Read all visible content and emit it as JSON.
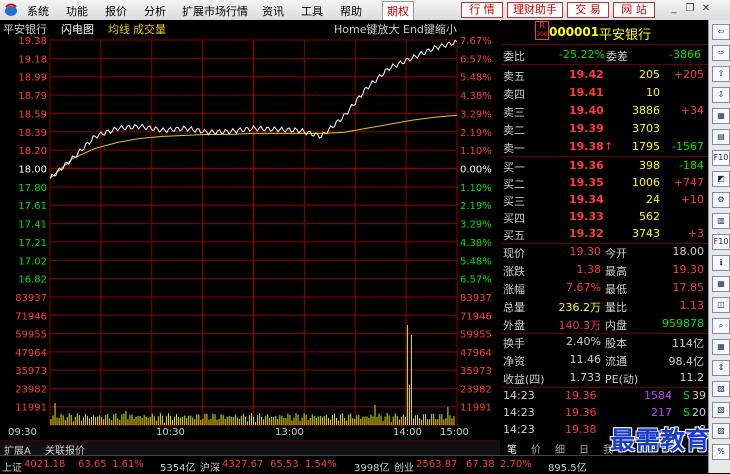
{
  "menu": {
    "items": [
      "系统",
      "功能",
      "报价",
      "分析",
      "扩展市场行情",
      "资讯",
      "工具",
      "帮助"
    ],
    "active": "期权",
    "buttons": [
      "行 情",
      "理财助手",
      "交 易",
      "网 站"
    ]
  },
  "chart": {
    "stock_name": "平安银行",
    "chart_label": "闪电图",
    "avg_label": "均线",
    "vol_label": "成交量",
    "hint": "Home键放大 End键缩小",
    "price_ticks_left": [
      "19.38",
      "19.18",
      "18.99",
      "18.79",
      "18.59",
      "18.39",
      "18.20",
      "18.00",
      "17.80",
      "17.61",
      "17.41",
      "17.21",
      "17.02",
      "16.82"
    ],
    "pct_ticks_right": [
      "7.67%",
      "6.57%",
      "5.48%",
      "4.38%",
      "3.29%",
      "2.19%",
      "1.10%",
      "0.00%",
      "1.10%",
      "2.19%",
      "3.29%",
      "4.38%",
      "5.48%",
      "6.57%"
    ],
    "vol_ticks_left": [
      "83937",
      "71946",
      "59955",
      "47964",
      "35973",
      "23982",
      "11991"
    ],
    "vol_ticks_right": [
      "83937",
      "71946",
      "59955",
      "47964",
      "35973",
      "23982",
      "11991"
    ],
    "time_ticks": [
      "09:30",
      "10:30",
      "13:00",
      "14:00",
      "15:00"
    ],
    "colors": {
      "price": "#ffffff",
      "avg": "#e6c800",
      "grid": "#8b0000",
      "volume": "#e6e600",
      "up": "#ff3b3b",
      "flat": "#ffffff",
      "down": "#00e400"
    }
  },
  "chart_data": {
    "type": "line",
    "title": "平安银行",
    "x": [
      "09:30",
      "09:45",
      "10:00",
      "10:15",
      "10:30",
      "10:45",
      "11:00",
      "11:15",
      "11:30",
      "13:15",
      "13:30",
      "13:45",
      "14:00",
      "14:10",
      "14:20",
      "14:30",
      "14:40",
      "14:50",
      "15:00"
    ],
    "series": [
      {
        "name": "",
        "values": [
          18.0,
          18.2,
          18.42,
          18.5,
          18.52,
          18.48,
          18.5,
          18.46,
          18.47,
          18.5,
          18.49,
          18.48,
          18.42,
          18.62,
          18.9,
          19.1,
          19.2,
          19.3,
          19.36
        ]
      },
      {
        "name": "均线",
        "values": [
          18.0,
          18.2,
          18.3,
          18.36,
          18.4,
          18.42,
          18.43,
          18.44,
          18.44,
          18.45,
          18.45,
          18.45,
          18.45,
          18.46,
          18.5,
          18.54,
          18.58,
          18.61,
          18.63
        ]
      }
    ],
    "ylim": [
      16.82,
      19.38
    ],
    "volume_ylim": [
      0,
      83937
    ]
  },
  "quote": {
    "code": "000001",
    "name": "平安银行",
    "badge_top": "R",
    "badge_bottom": "300",
    "weibi_label": "委比",
    "weibi_value": "-25.22%",
    "weicha_label": "委差",
    "weicha_value": "-3866",
    "asks": [
      {
        "label": "卖五",
        "price": "19.42",
        "vol": "205",
        "chg": "+205"
      },
      {
        "label": "卖四",
        "price": "19.41",
        "vol": "10",
        "chg": ""
      },
      {
        "label": "卖三",
        "price": "19.40",
        "vol": "3886",
        "chg": "+34"
      },
      {
        "label": "卖二",
        "price": "19.39",
        "vol": "3703",
        "chg": ""
      },
      {
        "label": "卖一",
        "price": "19.38",
        "vol": "1795",
        "chg": "-1567",
        "arrow": "↑"
      }
    ],
    "bids": [
      {
        "label": "买一",
        "price": "19.36",
        "vol": "398",
        "chg": "-184"
      },
      {
        "label": "买二",
        "price": "19.35",
        "vol": "1006",
        "chg": "+747"
      },
      {
        "label": "买三",
        "price": "19.34",
        "vol": "24",
        "chg": "+10"
      },
      {
        "label": "买四",
        "price": "19.33",
        "vol": "562",
        "chg": ""
      },
      {
        "label": "买五",
        "price": "19.32",
        "vol": "3743",
        "chg": "+3"
      }
    ],
    "stats": [
      {
        "l1": "现价",
        "v1": "19.30",
        "l2": "今开",
        "v2": "18.00"
      },
      {
        "l1": "涨跌",
        "v1": "1.38",
        "l2": "最高",
        "v2": "19.30"
      },
      {
        "l1": "涨幅",
        "v1": "7.67%",
        "l2": "最低",
        "v2": "17.85"
      },
      {
        "l1": "总量",
        "v1": "236.2万",
        "l2": "量比",
        "v2": "1.13"
      },
      {
        "l1": "外盘",
        "v1": "140.3万",
        "l2": "内盘",
        "v2": "959878"
      }
    ],
    "stats2": [
      {
        "l1": "换手",
        "v1": "2.40%",
        "l2": "股本",
        "v2": "114亿"
      },
      {
        "l1": "净资",
        "v1": "11.46",
        "l2": "流通",
        "v2": "98.4亿"
      },
      {
        "l1": "收益(四)",
        "v1": "1.733",
        "l2": "PE(动)",
        "v2": "11.2"
      }
    ],
    "ticks": [
      {
        "time": "14:23",
        "price": "19.36",
        "vol": "1584",
        "side": "S",
        "num": "39"
      },
      {
        "time": "14:23",
        "price": "19.36",
        "vol": "217",
        "side": "S",
        "num": "20"
      },
      {
        "time": "14:23",
        "price": "19.38",
        "vol": "",
        "side": "",
        "num": "8"
      }
    ]
  },
  "bottom_tabs": [
    "扩展A",
    "关联报价"
  ],
  "quote_tabs": [
    "笔",
    "价",
    "细",
    "日",
    "我"
  ],
  "status": {
    "sh_label": "上证",
    "sh_value": "4021.18",
    "sh_chg": "63.65",
    "sh_pct": "1.61%",
    "sh_amt": "5354亿",
    "sz_label": "沪深",
    "sz_value": "4327.67",
    "sz_chg": "65.53",
    "sz_pct": "1.54%",
    "sz_amt": "3998亿",
    "cy_label": "创业",
    "cy_value": "2563.87",
    "cy_chg": "67.38",
    "cy_pct": "2.70%",
    "cy_amt": "895.5亿"
  },
  "watermark": "最需教育",
  "sidebar_icons": [
    "back-icon",
    "forward-icon",
    "up-icon",
    "down-icon",
    "quote-icon",
    "chart-icon",
    "f10-icon",
    "kline-icon",
    "tools-icon",
    "fund-icon",
    "f10-icon",
    "info-icon",
    "table-icon",
    "trend-icon",
    "search-icon",
    "grid-icon",
    "scroll-icon",
    "chart2-icon",
    "chart3-icon",
    "chart4-icon",
    "pct-icon"
  ]
}
